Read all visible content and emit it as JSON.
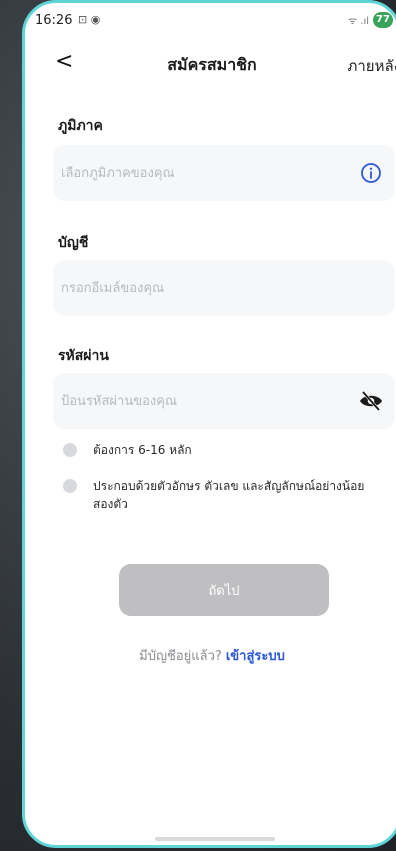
{
  "status_bar": {
    "time": "16:26",
    "left_icons": "⊡ ◉",
    "signal": "ᯤ .ıl",
    "battery": "77"
  },
  "nav": {
    "back_icon": "chevron-left-icon",
    "back_glyph": "<",
    "title": "สมัครสมาชิก",
    "later_label": "ภายหลัง"
  },
  "form": {
    "region": {
      "label": "ภูมิภาค",
      "placeholder": "เลือกภูมิภาคของคุณ",
      "icon": "info-icon"
    },
    "account": {
      "label": "บัญชี",
      "placeholder": "กรอกอีเมล์ของคุณ"
    },
    "password": {
      "label": "รหัสผ่าน",
      "placeholder": "ป้อนรหัสผ่านของคุณ",
      "icon": "eye-off-icon"
    },
    "rules": [
      "ต้องการ 6-16 หลัก",
      "ประกอบด้วยตัวอักษร ตัวเลข และสัญลักษณ์อย่างน้อยสองตัว"
    ]
  },
  "actions": {
    "next_label": "ถัดไป",
    "have_account_text": "มีบัญชีอยู่แล้ว?",
    "login_link": "เข้าสู่ระบบ"
  },
  "colors": {
    "accent": "#2c58d9",
    "frame": "#5fd6d6",
    "button_disabled": "#bfbfc2",
    "field_bg": "#f6f7f9"
  }
}
